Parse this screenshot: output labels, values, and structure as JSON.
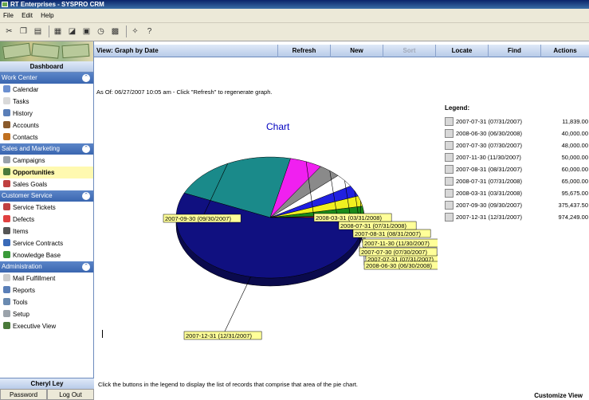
{
  "window": {
    "title": "RT Enterprises - SYSPRO CRM"
  },
  "menu": [
    "File",
    "Edit",
    "Help"
  ],
  "toolbar": {
    "icons": [
      "cut-icon",
      "copy-icon",
      "paste-icon",
      "sep",
      "report-icon",
      "chart-icon",
      "print-icon",
      "clock-icon",
      "calendar-icon",
      "sep",
      "wand-icon",
      "help-icon"
    ],
    "glyphs": [
      "✂",
      "❐",
      "▤",
      "",
      "▦",
      "◪",
      "▣",
      "◷",
      "▩",
      "",
      "✧",
      "?"
    ]
  },
  "sidebar": {
    "dashboard": "Dashboard",
    "sections": [
      {
        "title": "Work Center",
        "items": [
          {
            "label": "Calendar",
            "icon": "calendar-icon",
            "color": "#6b8fd0"
          },
          {
            "label": "Tasks",
            "icon": "tasks-icon",
            "color": "#d9d9d9"
          },
          {
            "label": "History",
            "icon": "history-icon",
            "color": "#5a7fb8"
          },
          {
            "label": "Accounts",
            "icon": "accounts-icon",
            "color": "#8a5a2b"
          },
          {
            "label": "Contacts",
            "icon": "contacts-icon",
            "color": "#c07020"
          }
        ]
      },
      {
        "title": "Sales and Marketing",
        "items": [
          {
            "label": "Campaigns",
            "icon": "campaigns-icon",
            "color": "#9aa2aa"
          },
          {
            "label": "Opportunities",
            "icon": "opportunities-icon",
            "color": "#4a7a3a",
            "selected": true
          },
          {
            "label": "Sales Goals",
            "icon": "sales-goals-icon",
            "color": "#c04040"
          }
        ]
      },
      {
        "title": "Customer Service",
        "items": [
          {
            "label": "Service Tickets",
            "icon": "service-tickets-icon",
            "color": "#c04040"
          },
          {
            "label": "Defects",
            "icon": "defects-icon",
            "color": "#e04040"
          },
          {
            "label": "Items",
            "icon": "items-icon",
            "color": "#555555"
          },
          {
            "label": "Service Contracts",
            "icon": "service-contracts-icon",
            "color": "#3a6ab8"
          },
          {
            "label": "Knowledge Base",
            "icon": "knowledge-base-icon",
            "color": "#3a9a3a"
          }
        ]
      },
      {
        "title": "Administration",
        "items": [
          {
            "label": "Mail Fulfillment",
            "icon": "mail-icon",
            "color": "#cccccc"
          },
          {
            "label": "Reports",
            "icon": "reports-icon",
            "color": "#5a7fb8"
          },
          {
            "label": "Tools",
            "icon": "tools-icon",
            "color": "#6a8ab0"
          },
          {
            "label": "Setup",
            "icon": "setup-icon",
            "color": "#9aa2aa"
          },
          {
            "label": "Executive View",
            "icon": "executive-view-icon",
            "color": "#4a7a3a"
          }
        ]
      }
    ],
    "user": "Cheryl Ley",
    "password": "Password",
    "logout": "Log Out"
  },
  "view": {
    "title": "View: Graph by Date",
    "buttons": [
      {
        "label": "Refresh",
        "disabled": false
      },
      {
        "label": "New",
        "disabled": false
      },
      {
        "label": "Sort",
        "disabled": true
      },
      {
        "label": "Locate",
        "disabled": false
      },
      {
        "label": "Find",
        "disabled": false
      },
      {
        "label": "Actions",
        "disabled": false
      }
    ]
  },
  "content": {
    "asof": "As Of: 06/27/2007 10:05 am - Click \"Refresh\" to regenerate graph.",
    "hint": "Click the buttons in the legend to display the list of records that comprise that area of the pie chart.",
    "customize": "Customize View"
  },
  "chart_data": {
    "type": "pie",
    "title": "Chart",
    "legend_title": "Legend:",
    "legend_position": "right",
    "slices": [
      {
        "label": "2007-07-31 (07/31/2007)",
        "value": 11839.0,
        "display": "11,839.00",
        "color": "#e82020"
      },
      {
        "label": "2008-06-30 (06/30/2008)",
        "value": 40000.0,
        "display": "40,000.00",
        "color": "#1a8a1a"
      },
      {
        "label": "2007-07-30 (07/30/2007)",
        "value": 48000.0,
        "display": "48,000.00",
        "color": "#f0f020"
      },
      {
        "label": "2007-11-30 (11/30/2007)",
        "value": 50000.0,
        "display": "50,000.00",
        "color": "#2020e0"
      },
      {
        "label": "2007-08-31 (08/31/2007)",
        "value": 60000.0,
        "display": "60,000.00",
        "color": "#ffffff"
      },
      {
        "label": "2008-07-31 (07/31/2008)",
        "value": 65000.0,
        "display": "65,000.00",
        "color": "#8a8a8a"
      },
      {
        "label": "2008-03-31 (03/31/2008)",
        "value": 95675.0,
        "display": "95,675.00",
        "color": "#f020f0"
      },
      {
        "label": "2007-09-30 (09/30/2007)",
        "value": 375437.5,
        "display": "375,437.50",
        "color": "#1a8a8a"
      },
      {
        "label": "2007-12-31 (12/31/2007)",
        "value": 974249.0,
        "display": "974,249.00",
        "color": "#101080"
      }
    ]
  }
}
